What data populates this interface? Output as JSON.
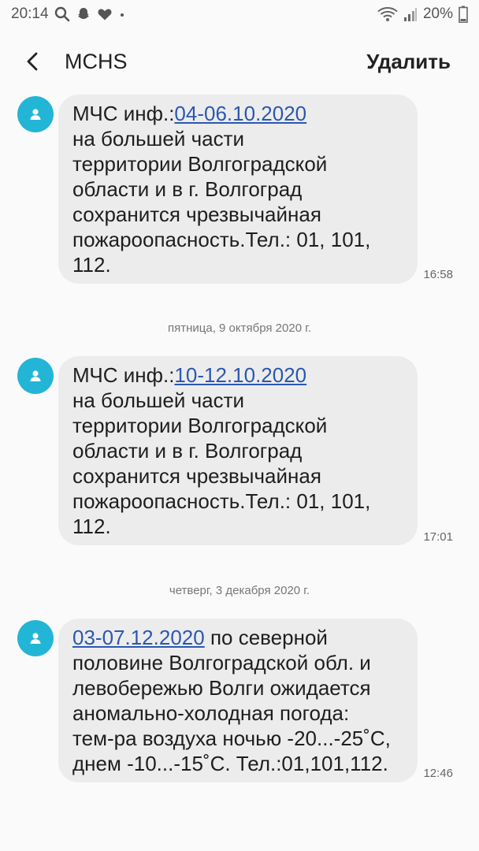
{
  "status_bar": {
    "time": "20:14",
    "left_icons": [
      "search-icon",
      "snapchat-icon",
      "heart-icon",
      "dot-icon"
    ],
    "right_icons": [
      "wifi-icon",
      "signal-icon"
    ],
    "battery": "20%"
  },
  "header": {
    "contact": "MCHS",
    "delete_label": "Удалить"
  },
  "separators": {
    "date1": "пятница, 9 октября 2020 г.",
    "date2": "четверг, 3 декабря 2020 г."
  },
  "messages": [
    {
      "prefix": "МЧС инф.:",
      "link": "04-06.10.2020",
      "line1_rest": "",
      "lines": [
        "на большей части",
        "территории Волгоградской",
        "области и в г. Волгоград",
        "сохранится чрезвычайная",
        "пожароопасность.Тел.: 01, 101,",
        "112."
      ],
      "time": "16:58"
    },
    {
      "prefix": "МЧС инф.:",
      "link": "10-12.10.2020",
      "line1_rest": "",
      "lines": [
        "на большей части",
        "территории Волгоградской",
        "области и в г. Волгоград",
        "сохранится чрезвычайная",
        "пожароопасность.Тел.: 01, 101,",
        "112."
      ],
      "time": "17:01"
    },
    {
      "prefix": "",
      "link": "03-07.12.2020",
      "line1_rest": " по северной",
      "lines": [
        "половине Волгоградской обл. и",
        "левобережью Волги ожидается",
        "аномально-холодная погода:",
        "тем-ра воздуха ночью -20...-25˚С,",
        "днем -10...-15˚С. Тел.:01,101,112."
      ],
      "time": "12:46"
    }
  ],
  "colors": {
    "avatar": "#22b5d6",
    "bubble": "#ececec",
    "link": "#2a58b0"
  }
}
